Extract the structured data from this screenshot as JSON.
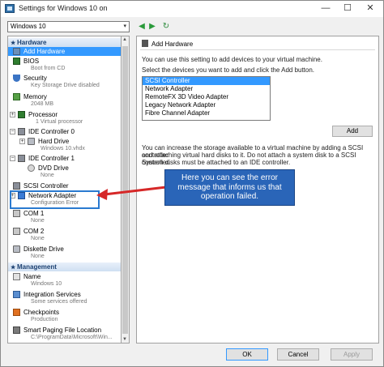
{
  "window": {
    "title": "Settings for Windows 10 on",
    "minimize": "—",
    "maximize": "☐",
    "close": "✕"
  },
  "vm_select": {
    "value": "Windows 10",
    "arrow": "▾"
  },
  "nav": {
    "back": "◀",
    "forward": "▶",
    "refresh": "↻"
  },
  "tree": {
    "hardware_header": "Hardware",
    "management_header": "Management",
    "items": {
      "add_hardware": {
        "label": "Add Hardware",
        "icon": "add-hardware-icon"
      },
      "bios": {
        "label": "BIOS",
        "sub": "Boot from CD",
        "icon": "chip-icon"
      },
      "security": {
        "label": "Security",
        "sub": "Key Storage Drive disabled",
        "icon": "shield-icon"
      },
      "memory": {
        "label": "Memory",
        "sub": "2048 MB",
        "icon": "memory-icon"
      },
      "processor": {
        "label": "Processor",
        "sub": "1 Virtual processor",
        "icon": "processor-icon"
      },
      "ide0": {
        "label": "IDE Controller 0",
        "icon": "controller-icon"
      },
      "hard_drive": {
        "label": "Hard Drive",
        "sub": "Windows 10.vhdx",
        "icon": "disk-icon"
      },
      "ide1": {
        "label": "IDE Controller 1",
        "icon": "controller-icon"
      },
      "dvd": {
        "label": "DVD Drive",
        "sub": "None",
        "icon": "dvd-icon"
      },
      "scsi": {
        "label": "SCSI Controller",
        "icon": "controller-icon"
      },
      "network": {
        "label": "Network Adapter",
        "sub": "Configuration Error",
        "icon": "network-icon"
      },
      "com1": {
        "label": "COM 1",
        "sub": "None",
        "icon": "com-icon"
      },
      "com2": {
        "label": "COM 2",
        "sub": "None",
        "icon": "com-icon"
      },
      "diskette": {
        "label": "Diskette Drive",
        "sub": "None",
        "icon": "diskette-icon"
      },
      "name": {
        "label": "Name",
        "sub": "Windows 10",
        "icon": "name-icon"
      },
      "integration": {
        "label": "Integration Services",
        "sub": "Some services offered",
        "icon": "services-icon"
      },
      "checkpoints": {
        "label": "Checkpoints",
        "sub": "Production",
        "icon": "checkpoint-icon"
      },
      "paging": {
        "label": "Smart Paging File Location",
        "sub": "C:\\ProgramData\\Microsoft\\Win...",
        "icon": "paging-icon"
      }
    }
  },
  "panel": {
    "title": "Add Hardware",
    "intro": "You can use this setting to add devices to your virtual machine.",
    "instruction": "Select the devices you want to add and click the Add button.",
    "devices": [
      "SCSI Controller",
      "Network Adapter",
      "RemoteFX 3D Video Adapter",
      "Legacy Network Adapter",
      "Fibre Channel Adapter"
    ],
    "selected_device_index": 0,
    "add_button": "Add",
    "info_lines": [
      "You can increase the storage available to a virtual machine by adding a SCSI controller",
      "and attaching virtual hard disks to it. Do not attach a system disk to a SCSI controller.",
      "System disks must be attached to an IDE controller."
    ]
  },
  "callout": {
    "lines": [
      "Here you can see the error",
      "message that informs us that",
      "operation failed."
    ],
    "color": "#2a65b8"
  },
  "arrow_color": "#d62828",
  "buttons": {
    "ok": "OK",
    "cancel": "Cancel",
    "apply": "Apply"
  }
}
